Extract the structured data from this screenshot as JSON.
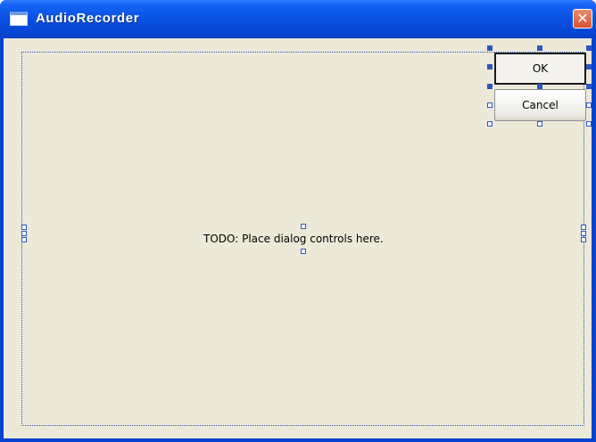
{
  "window": {
    "title": "AudioRecorder",
    "close_glyph": "✕",
    "title_icon": "window-icon",
    "close_icon": "close-icon"
  },
  "dialog": {
    "ok_label": "OK",
    "cancel_label": "Cancel",
    "placeholder_text": "TODO: Place dialog controls here."
  },
  "colors": {
    "titlebar": "#0a55e6",
    "dialog_background": "#ece9d8",
    "selection_handle": "#2d56c4",
    "close_button": "#d5532f"
  }
}
